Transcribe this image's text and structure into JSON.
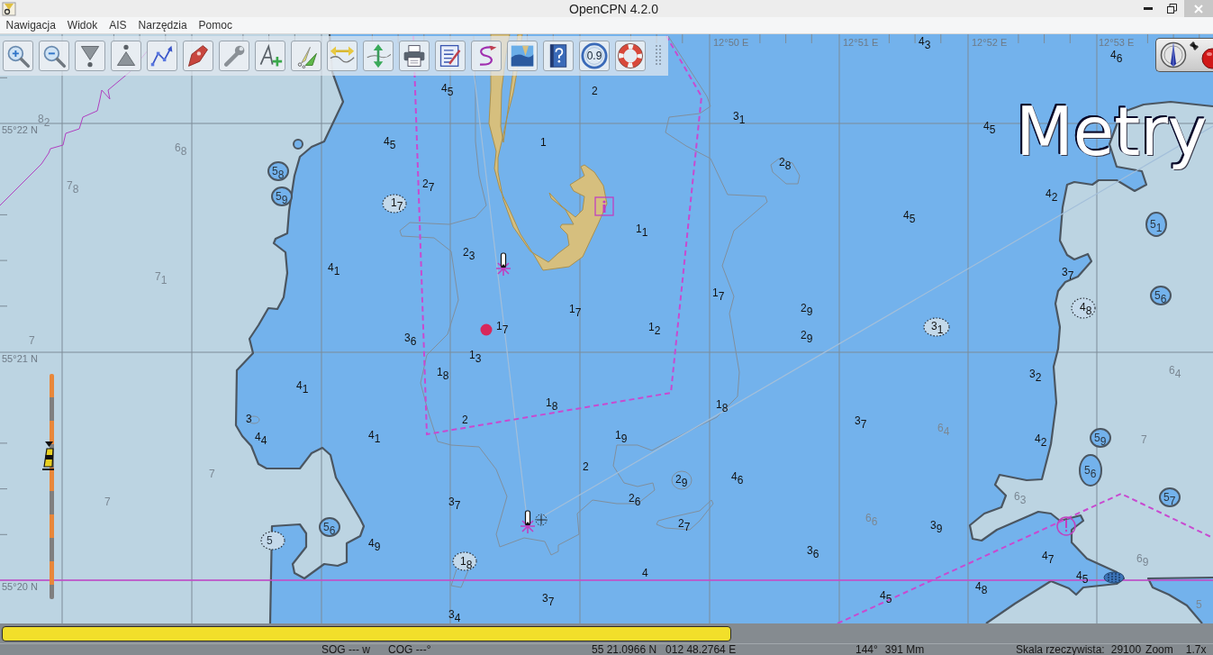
{
  "window": {
    "title": "OpenCPN 4.2.0"
  },
  "menu": [
    "Nawigacja",
    "Widok",
    "AIS",
    "Narzędzia",
    "Pomoc"
  ],
  "toolbar": {
    "dial_reading": "0.9"
  },
  "chart": {
    "latitude_labels": [
      "55°22 N",
      "55°21 N",
      "55°20 N"
    ],
    "longitude_labels": [
      "12°50 E",
      "12°51 E",
      "12°52 E",
      "12°53 E"
    ],
    "depth_unit_overlay": "Metry",
    "soundings_shallow": [
      "4$_{3}$",
      "4$_{6}$",
      "4$_{5}$",
      "2",
      "3$_{1}$",
      "4$_{5}$",
      "4$_{5}$",
      "1",
      "2$_{8}$",
      "2$_{7}$",
      "4$_{2}$",
      "1$_{7}$",
      "4$_{5}$",
      "1$_{1}$",
      "2$_{3}$",
      "4$_{1}$",
      "3$_{7}$",
      "1$_{7}$",
      "1$_{7}$",
      "2$_{9}$",
      "4$_{8}$",
      "1$_{7}$",
      "1$_{2}$",
      "3$_{1}$",
      "3$_{6}$",
      "2$_{9}$",
      "1$_{3}$",
      "1$_{8}$",
      "3$_{2}$",
      "4$_{1}$",
      "1$_{8}$",
      "1$_{8}$",
      "3",
      "2",
      "3$_{7}$",
      "4$_{4}$",
      "4$_{1}$",
      "1$_{9}$",
      "4$_{2}$",
      "2",
      "2$_{9}$",
      "4$_{6}$",
      "3$_{7}$",
      "2$_{6}$",
      "2$_{7}$",
      "3$_{9}$",
      "4$_{9}$",
      "3$_{6}$",
      "1$_{8}$",
      "4$_{7}$",
      "4",
      "4$_{5}$",
      "4$_{8}$",
      "3$_{7}$",
      "4$_{5}$",
      "3$_{4}$"
    ],
    "soundings_deep": [
      "8$_{2}$",
      "6$_{8}$",
      "5$_{8}$",
      "7$_{8}$",
      "5$_{9}$",
      "5$_{1}$",
      "7$_{1}$",
      "5$_{6}$",
      "7",
      "6$_{4}$",
      "6$_{4}$",
      "5$_{9}$",
      "7",
      "7",
      "5$_{6}$",
      "7",
      "6$_{3}$",
      "5$_{7}$",
      "6$_{6}$",
      "5$_{6}$",
      "5",
      "6$_{9}$",
      "5"
    ]
  },
  "status_bar": {
    "sog": "SOG --- w",
    "cog": "COG ---°",
    "latitude": "55 21.0966 N",
    "longitude": "012 48.2764 E",
    "bearing": "144°",
    "distance": "391 Mm",
    "scale_label": "Skala rzeczywista:",
    "scale_value": "29100",
    "zoom_label": "Zoom",
    "zoom_value": "1.7x"
  }
}
